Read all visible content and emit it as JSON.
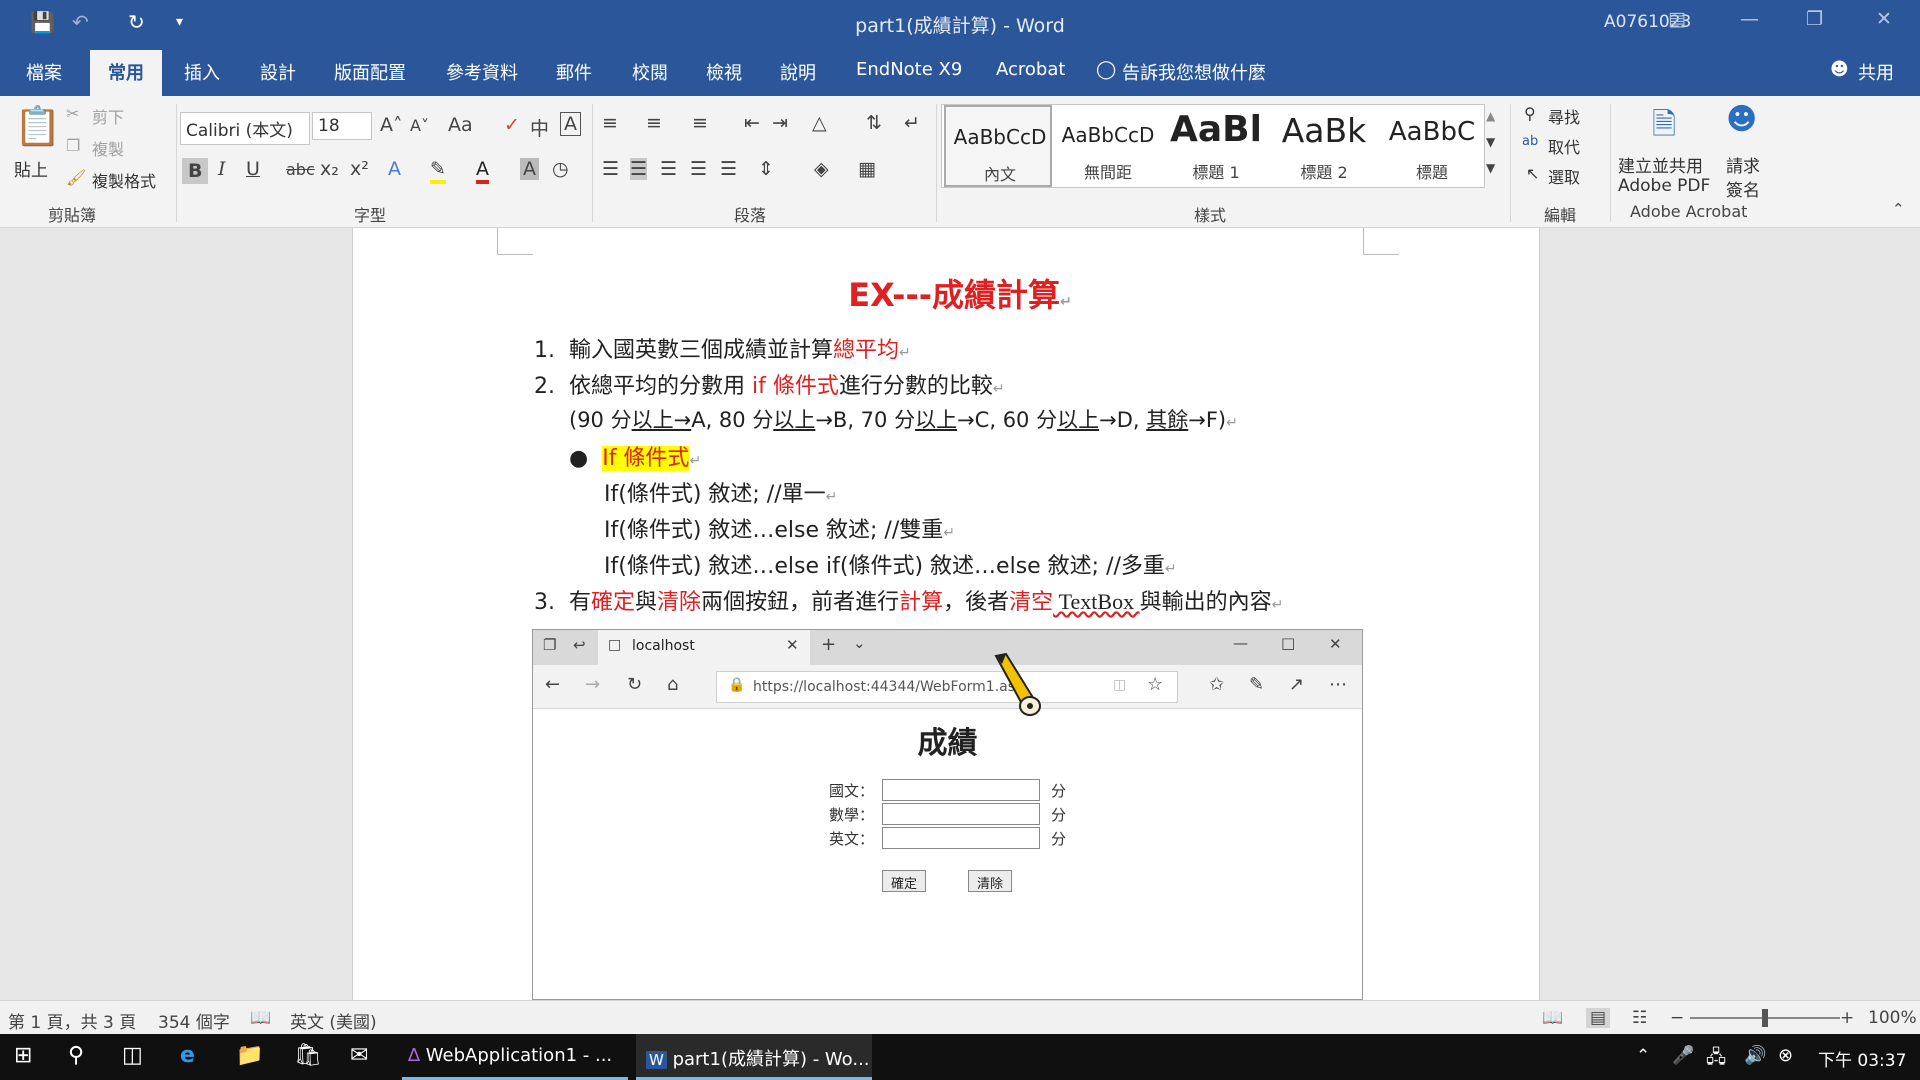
{
  "titlebar": {
    "title": "part1(成績計算) - Word",
    "user": "A0761023",
    "icons": [
      "save-icon",
      "undo-icon",
      "redo-icon",
      "customize-icon"
    ]
  },
  "tabs": [
    "檔案",
    "常用",
    "插入",
    "設計",
    "版面配置",
    "參考資料",
    "郵件",
    "校閱",
    "檢視",
    "說明",
    "EndNote X9",
    "Acrobat",
    "告訴我您想做什麼"
  ],
  "share_label": "共用",
  "clipboard": {
    "paste": "貼上",
    "cut": "剪下",
    "copy": "複製",
    "format_painter": "複製格式",
    "label": "剪貼簿"
  },
  "font": {
    "name": "Calibri (本文)",
    "size": "18",
    "case": "Aa",
    "label": "字型",
    "bold": "B",
    "italic": "I",
    "underline": "U",
    "strike": "abc"
  },
  "paragraph": {
    "label": "段落"
  },
  "styles": {
    "label": "樣式",
    "items": [
      {
        "preview": "AaBbCcD",
        "name": "內文"
      },
      {
        "preview": "AaBbCcD",
        "name": "無間距"
      },
      {
        "preview": "AaBl",
        "name": "標題 1"
      },
      {
        "preview": "AaBk",
        "name": "標題 2"
      },
      {
        "preview": "AaBbC",
        "name": "標題"
      }
    ]
  },
  "editing": {
    "find": "尋找",
    "replace": "取代",
    "select": "選取",
    "label": "編輯"
  },
  "acrobat": {
    "create_share": "建立並共用",
    "adobe_pdf": "Adobe PDF",
    "request": "請求",
    "sign": "簽名",
    "label": "Adobe Acrobat"
  },
  "document": {
    "title": "EX---成績計算",
    "item1_num": "1.",
    "item1_a": "輸入國英數三個成績並計算",
    "item1_b": "總平均",
    "item2_num": "2.",
    "item2_a": "依總平均的分數用 ",
    "item2_b": "if 條件式",
    "item2_c": "進行分數的比較",
    "grade_a": "(90 分",
    "grade_b": "以上→",
    "grade_c": "A, 80 分",
    "grade_d": "以上",
    "grade_e": "→B, 70 分",
    "grade_f": "以上",
    "grade_g": "→C, 60 分",
    "grade_h": "以上",
    "grade_i": "→D,  ",
    "grade_j": "其餘",
    "grade_k": "→F)",
    "bullet": "If 條件式",
    "code1": "If(條件式)  敘述;      //單一",
    "code2": "If(條件式)  敘述…else  敘述;      //雙重",
    "code3": "If(條件式)  敘述…else if(條件式)  敘述…else  敘述;      //多重",
    "item3_num": "3.",
    "item3_a": "有",
    "item3_b": "確定",
    "item3_c": "與",
    "item3_d": "清除",
    "item3_e": "兩個按鈕，前者進行",
    "item3_f": "計算",
    "item3_g": "，後者",
    "item3_h": "清空",
    "item3_i": " TextBox ",
    "item3_j": "與輸出的內容"
  },
  "browser": {
    "tab_title": "localhost",
    "url": "https://localhost:44344/WebForm1.asp",
    "page_title": "成績",
    "fields": [
      {
        "label": "國文：",
        "unit": "分"
      },
      {
        "label": "數學：",
        "unit": "分"
      },
      {
        "label": "英文：",
        "unit": "分"
      }
    ],
    "confirm": "確定",
    "clear": "清除"
  },
  "status": {
    "page": "第 1 頁，共 3 頁",
    "words": "354 個字",
    "language": "英文 (美國)",
    "zoom": "100%",
    "zoom_level": 0.5
  },
  "taskbar": {
    "app1": "WebApplication1 - ...",
    "app2": "part1(成績計算) - Wo...",
    "clock": "下午 03:37"
  }
}
